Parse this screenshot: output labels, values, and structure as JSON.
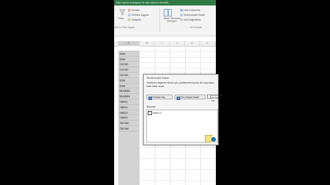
{
  "ribbon": {
    "title_bar": "Satır sayma fonksiyonu ile satır sayısını otomatik...",
    "filter_label": "Filtre",
    "clear_label": "Temizle",
    "reapply_label": "Yeniden Uygula",
    "advanced_label": "Gelişmiş",
    "sort_filter_group": "rala ve Filtre Uygula",
    "text_to_columns_label": "Metni Sütunlara Dönüştür",
    "flash_fill_label": "Hızlı Doldurma",
    "remove_duplicates_label": "Yinelenenleri Kaldır",
    "data_validation_label": "Veri Doğrulama",
    "data_tools_group": "Veri Araçları"
  },
  "columns": [
    "G",
    "H",
    "I",
    "J",
    "K",
    "L"
  ],
  "cells": [
    "Emir",
    "Emir",
    "Cemre",
    "Cemre",
    "Cemre",
    "Emir",
    "Emir",
    "Mustafa",
    "Mustafa",
    "Hatice",
    "Hatice",
    "Hatice",
    "Hatice",
    "Osman",
    "Osman"
  ],
  "dialog": {
    "title": "Yinelenenleri Kaldır",
    "description": "Yinelenen değerleri silmek için, yinelenenleri içeren bir veya daha fazla sütun seçin.",
    "select_all_button": "Tümünü Seç",
    "unselect_all_button": "Tüm Seçimi Kaldır",
    "headers_checkbox": "Verilerimde üst bilgi var",
    "columns_label": "Sütunlar",
    "list_items": [
      {
        "label": "Sütun G",
        "checked": true
      }
    ]
  },
  "colors": {
    "ribbon_accent": "#2f7a45",
    "selection": "#d3d3d3",
    "dialog_bg": "#f4f4f4"
  }
}
